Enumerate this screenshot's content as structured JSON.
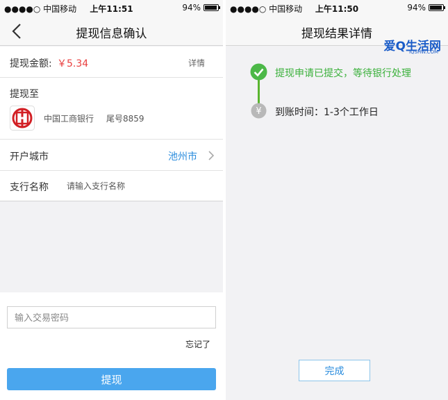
{
  "status_left": {
    "carrier": "●●●●○ 中国移动",
    "time": "上午11:51",
    "battery": "94%"
  },
  "status_right": {
    "carrier": "●●●●○ 中国移动",
    "time": "上午11:50",
    "battery": "94%"
  },
  "confirm": {
    "title": "提现信息确认",
    "amount_label": "提现金额:",
    "amount_value": "￥5.34",
    "detail_link": "详情",
    "withdraw_to_label": "提现至",
    "bank_name": "中国工商银行",
    "card_tail": "尾号8859",
    "city_label": "开户城市",
    "city_value": "池州市",
    "branch_label": "支行名称",
    "branch_placeholder": "请输入支行名称",
    "password_placeholder": "输入交易密码",
    "forgot_label": "忘记了",
    "submit_label": "提现"
  },
  "result": {
    "title": "提现结果详情",
    "step1": "提现申请已提交，等待银行处理",
    "step2": "到账时间：1-3个工作日",
    "done_label": "完成"
  },
  "brand": {
    "name": "爱Q生活网",
    "url": "IQSHW.COM"
  },
  "icons": {
    "back": "chevron-left-icon",
    "bank_logo": "icbc-logo-icon",
    "chevron": "chevron-right-icon",
    "step_done": "check-circle-icon",
    "step_pending": "yen-circle-icon"
  },
  "colors": {
    "accent_blue": "#4aa6ee",
    "amount_red": "#e94040",
    "success_green": "#3ab03a",
    "link_blue": "#2a8cdd"
  }
}
